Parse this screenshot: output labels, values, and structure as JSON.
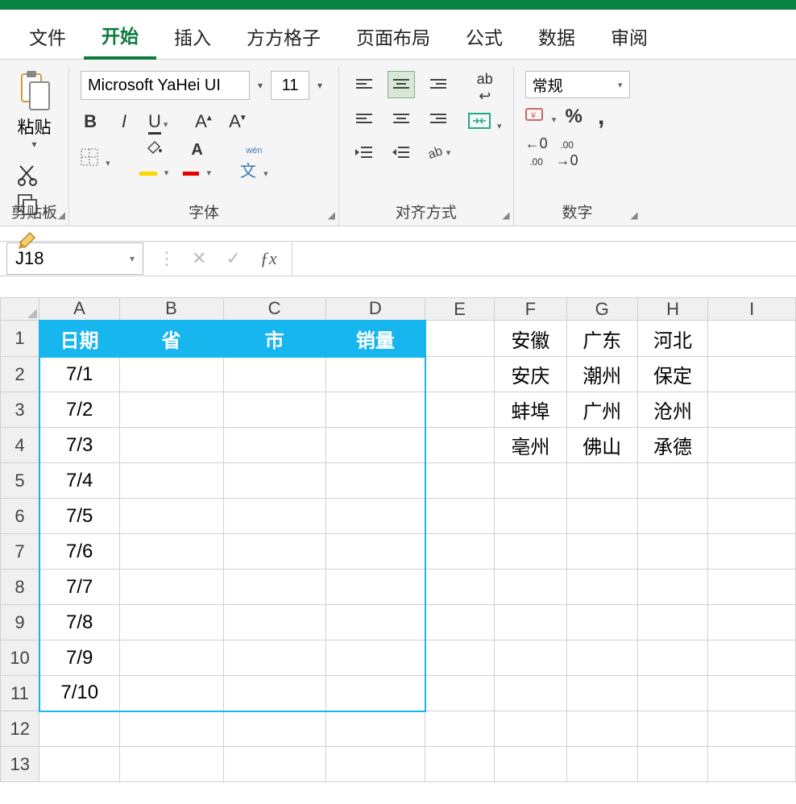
{
  "tabs": {
    "file": "文件",
    "home": "开始",
    "insert": "插入",
    "ffgz": "方方格子",
    "layout": "页面布局",
    "formula": "公式",
    "data": "数据",
    "review": "审阅"
  },
  "ribbon": {
    "clipboard": {
      "label": "剪贴板",
      "paste": "粘贴"
    },
    "font": {
      "label": "字体",
      "name": "Microsoft YaHei UI",
      "size": "11",
      "bold": "B",
      "italic": "I",
      "underline": "U",
      "wen": "wén",
      "wenChar": "文"
    },
    "align": {
      "label": "对齐方式",
      "wrap": "ab"
    },
    "number": {
      "label": "数字",
      "format": "常规",
      "pct": "%",
      "comma": ",",
      "dec_inc": ".00",
      "dec_dec": ".00"
    }
  },
  "namebox": "J18",
  "fx": "ƒx",
  "columns": [
    "A",
    "B",
    "C",
    "D",
    "E",
    "F",
    "G",
    "H",
    "I"
  ],
  "rows": [
    "1",
    "2",
    "3",
    "4",
    "5",
    "6",
    "7",
    "8",
    "9",
    "10",
    "11",
    "12",
    "13"
  ],
  "blueHeader": [
    "日期",
    "省",
    "市",
    "销量"
  ],
  "dates": [
    "7/1",
    "7/2",
    "7/3",
    "7/4",
    "7/5",
    "7/6",
    "7/7",
    "7/8",
    "7/9",
    "7/10"
  ],
  "side": {
    "r1": [
      "安徽",
      "广东",
      "河北"
    ],
    "r2": [
      "安庆",
      "潮州",
      "保定"
    ],
    "r3": [
      "蚌埠",
      "广州",
      "沧州"
    ],
    "r4": [
      "亳州",
      "佛山",
      "承德"
    ]
  }
}
